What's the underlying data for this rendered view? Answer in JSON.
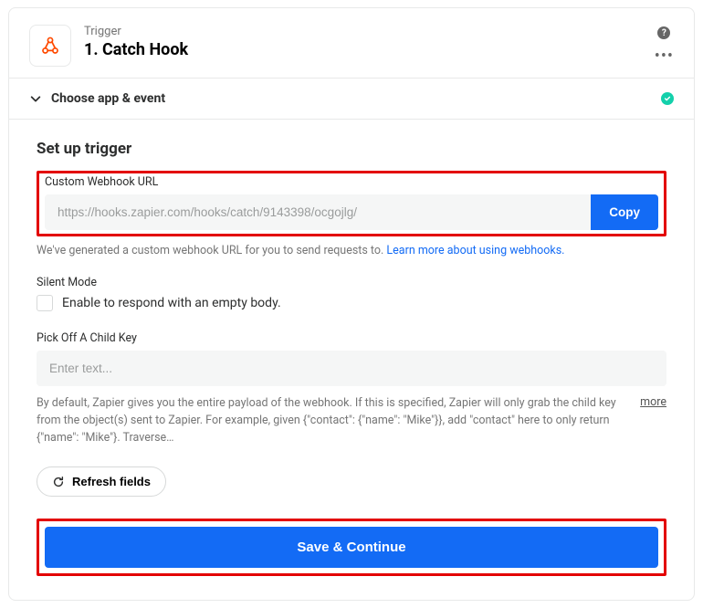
{
  "header": {
    "kicker": "Trigger",
    "title": "1. Catch Hook",
    "help_icon": "?",
    "more_icon": "•••"
  },
  "choose_section": {
    "label": "Choose app & event"
  },
  "setup": {
    "heading": "Set up trigger",
    "webhook": {
      "label": "Custom Webhook URL",
      "value": "https://hooks.zapier.com/hooks/catch/9143398/ocgojlg/",
      "copy_label": "Copy",
      "help_prefix": "We've generated a custom webhook URL for you to send requests to. ",
      "help_link": "Learn more about using webhooks."
    },
    "silent_mode": {
      "label": "Silent Mode",
      "checkbox_label": "Enable to respond with an empty body."
    },
    "child_key": {
      "label": "Pick Off A Child Key",
      "placeholder": "Enter text...",
      "description": "By default, Zapier gives you the entire payload of the webhook. If this is specified, Zapier will only grab the child key from the object(s) sent to Zapier. For example, given {\"contact\": {\"name\": \"Mike\"}}, add \"contact\" here to only return {\"name\": \"Mike\"}. Traverse…",
      "more": "more"
    },
    "refresh_label": "Refresh fields",
    "primary_label": "Save & Continue"
  }
}
